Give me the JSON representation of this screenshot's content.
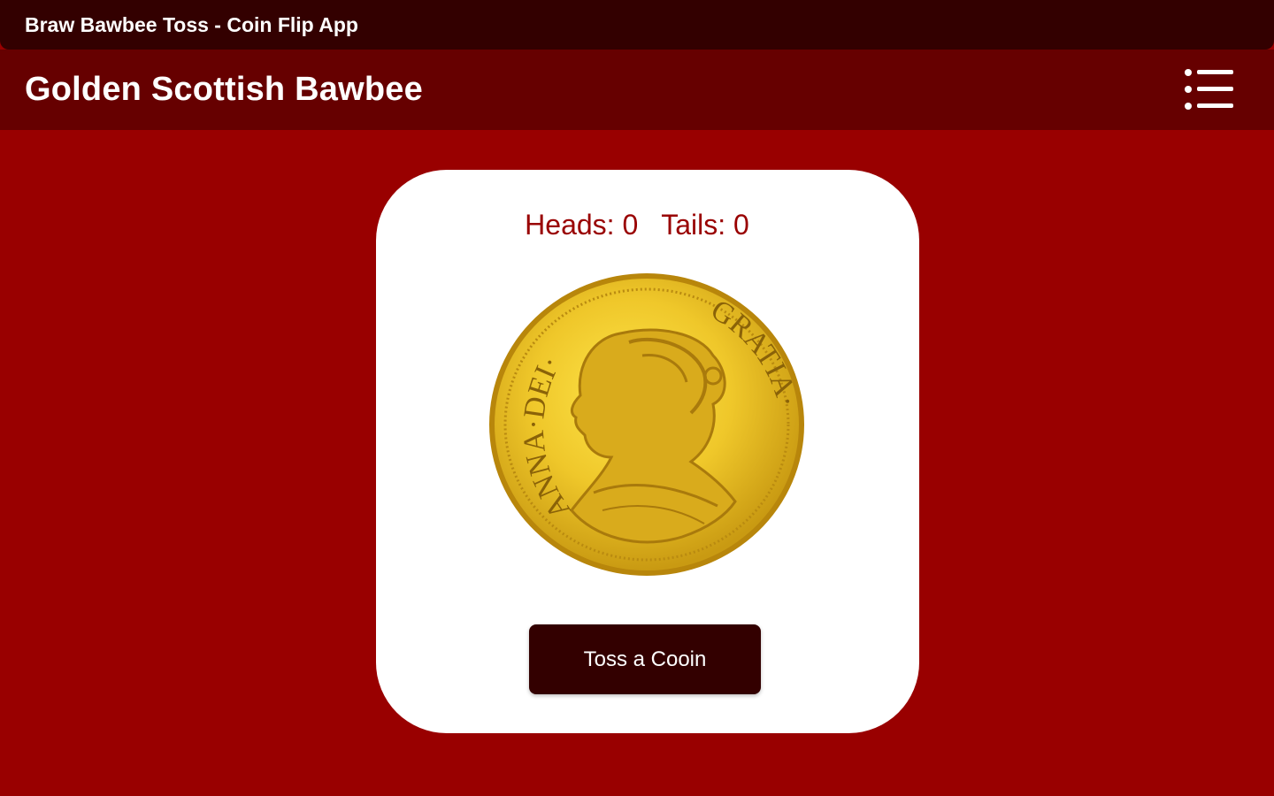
{
  "window": {
    "title": "Braw Bawbee Toss - Coin Flip App"
  },
  "appbar": {
    "title": "Golden Scottish Bawbee",
    "menu_icon": "list-menu-icon"
  },
  "scoreboard": {
    "heads_label": "Heads: 0",
    "tails_label": "Tails: 0"
  },
  "coin": {
    "icon": "gold-coin-portrait-icon",
    "inscription_left": "ANNA·DEI·",
    "inscription_right": "GRATIA·"
  },
  "actions": {
    "toss_label": "Toss a Cooin"
  },
  "colors": {
    "background": "#990000",
    "titlebar": "#330000",
    "appbar": "#660000",
    "card": "#ffffff",
    "score_text": "#990000",
    "button": "#330000",
    "coin_gold": "#e8c020"
  }
}
